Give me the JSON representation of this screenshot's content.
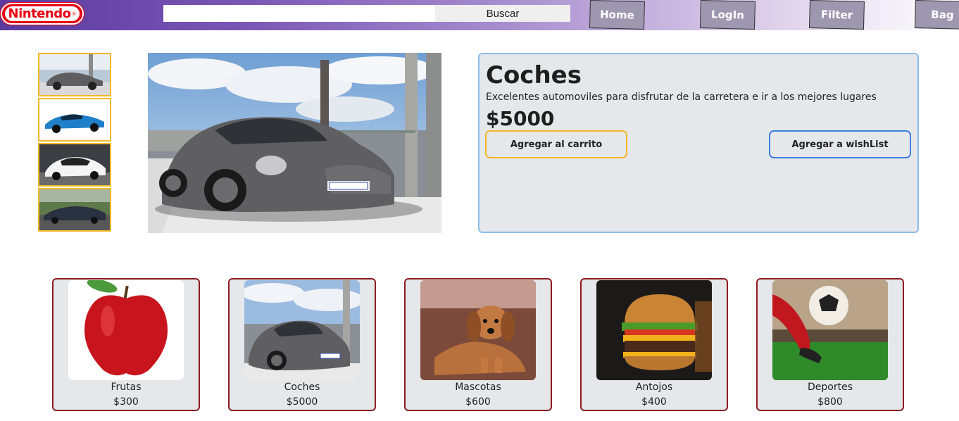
{
  "header": {
    "logo_text": "Nintendo",
    "logo_reg": "®",
    "search": {
      "value": "",
      "placeholder": "",
      "button_label": "Buscar"
    },
    "nav": {
      "home": "Home",
      "login": "LogIn",
      "filter": "Filter",
      "bag": "Bag"
    }
  },
  "product": {
    "title": "Coches",
    "description": "Excelentes automoviles para disfrutar de la carretera e ir a los mejores lugares",
    "price": "$5000",
    "add_to_cart_label": "Agregar al carrito",
    "add_to_wishlist_label": "Agregar a wishList",
    "thumbnails": [
      "grey-sports-car",
      "blue-convertible",
      "white-coupe",
      "dark-hypercar"
    ]
  },
  "cards": [
    {
      "name": "Frutas",
      "price": "$300",
      "image": "red-apple"
    },
    {
      "name": "Coches",
      "price": "$5000",
      "image": "grey-sports-car"
    },
    {
      "name": "Mascotas",
      "price": "$600",
      "image": "puppy"
    },
    {
      "name": "Antojos",
      "price": "$400",
      "image": "burger"
    },
    {
      "name": "Deportes",
      "price": "$800",
      "image": "soccer-kick"
    }
  ],
  "colors": {
    "thumb_border": "#f2b825",
    "detail_border": "#8fbde8",
    "cart_border": "#f2b825",
    "wish_border": "#3d7fd8",
    "card_border": "#8c1d22",
    "panel_bg": "#e5e7eb",
    "brand_red": "#e60012"
  }
}
